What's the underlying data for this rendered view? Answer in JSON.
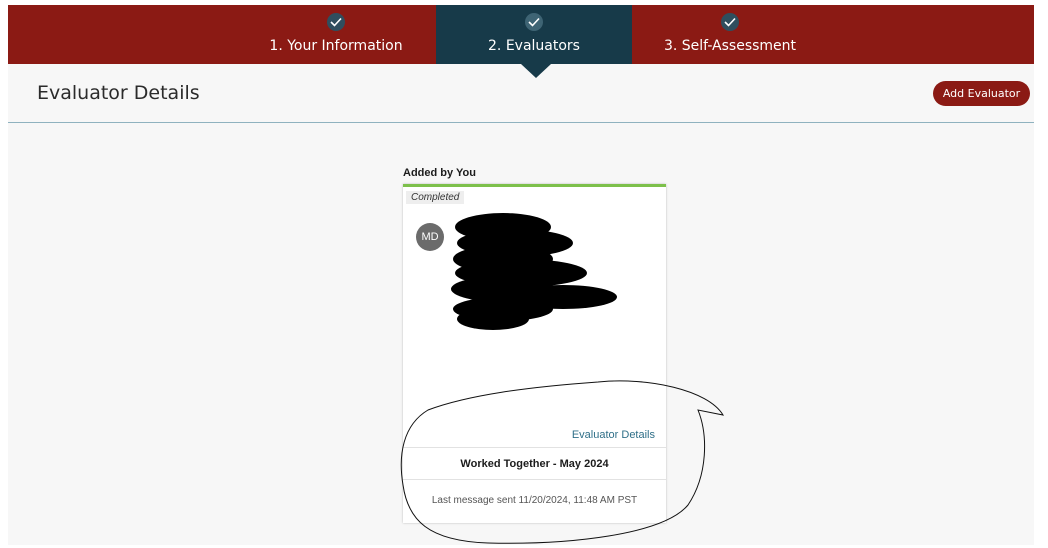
{
  "stepper": {
    "steps": [
      {
        "label": "1. Your Information",
        "status": "complete",
        "icon": "check-icon"
      },
      {
        "label": "2. Evaluators",
        "status": "active",
        "icon": "check-icon"
      },
      {
        "label": "3. Self-Assessment",
        "status": "complete",
        "icon": "check-icon"
      }
    ]
  },
  "header": {
    "title": "Evaluator Details",
    "add_button_label": "Add Evaluator"
  },
  "evaluators": {
    "section_label": "Added by You",
    "card": {
      "status": "Completed",
      "initials": "MD",
      "details_link": "Evaluator Details",
      "relationship": "Worked Together - May 2024",
      "last_message": "Last message sent 11/20/2024, 11:48 AM PST"
    }
  },
  "colors": {
    "brand_red": "#8b1a14",
    "active_step": "#173a49",
    "completed_bar": "#7dc04b",
    "link": "#2f6f88"
  }
}
